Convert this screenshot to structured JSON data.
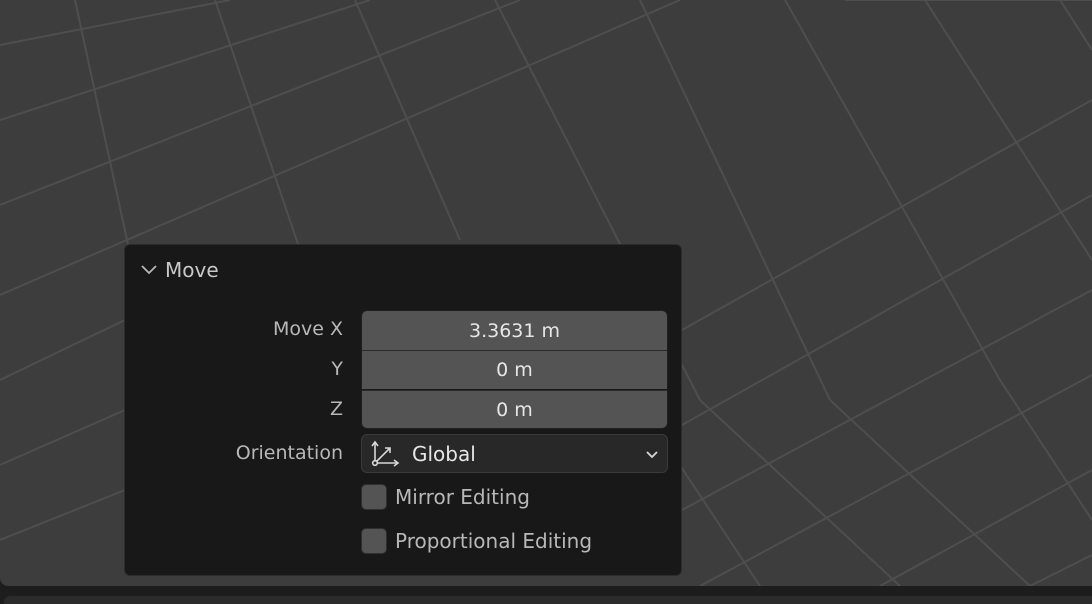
{
  "panel": {
    "title": "Move",
    "collapse_icon": "chevron-down-icon",
    "move_x_label": "Move X",
    "y_label": "Y",
    "z_label": "Z",
    "move_x_value": "3.3631 m",
    "y_value": "0 m",
    "z_value": "0 m",
    "orientation_label": "Orientation",
    "orientation_icon": "orientation-gizmo-icon",
    "orientation_value": "Global",
    "mirror_editing": {
      "label": "Mirror Editing",
      "checked": false
    },
    "proportional_editing": {
      "label": "Proportional Editing",
      "checked": false
    }
  },
  "colors": {
    "viewport_bg": "#3d3d3d",
    "grid_line": "#4e4e4e",
    "panel_bg": "#181818",
    "field_bg": "#545454"
  }
}
